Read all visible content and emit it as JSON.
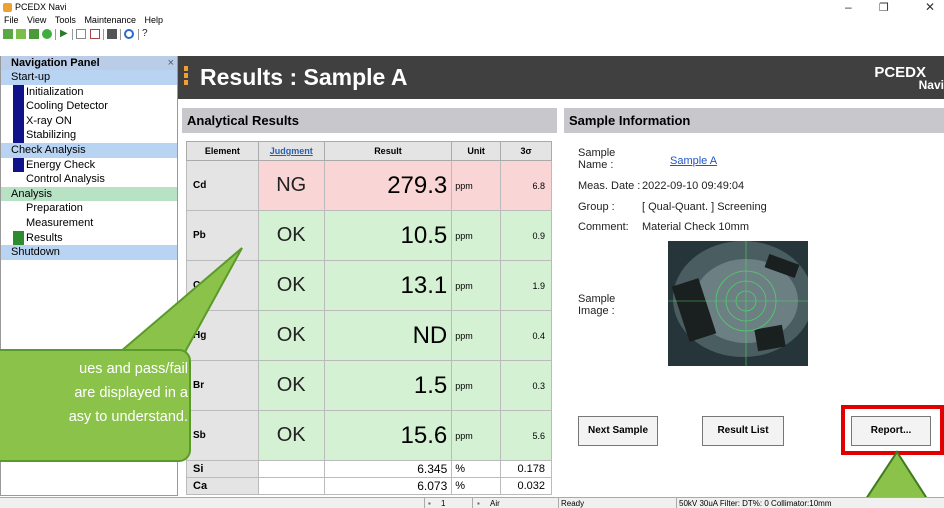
{
  "app": {
    "title": "PCEDX Navi",
    "menu": [
      "File",
      "View",
      "Tools",
      "Maintenance",
      "Help"
    ]
  },
  "nav": {
    "header": "Navigation Panel",
    "close": "×",
    "groups": [
      {
        "label": "Start-up",
        "items": [
          "Initialization",
          "Cooling Detector",
          "X-ray ON",
          "Stabilizing"
        ]
      },
      {
        "label": "Check Analysis",
        "items": [
          "Energy Check",
          "Control Analysis"
        ]
      },
      {
        "label": "Analysis",
        "items": [
          "Preparation",
          "Measurement",
          "Results"
        ]
      },
      {
        "label": "Shutdown",
        "items": []
      }
    ]
  },
  "header": {
    "title": "Results : Sample A",
    "brand": "PCEDX",
    "brand_sub": "Navi"
  },
  "results": {
    "section_title": "Analytical Results",
    "columns": [
      "Element",
      "Judgment",
      "Result",
      "Unit",
      "3σ"
    ],
    "rows": [
      {
        "element": "Cd",
        "judgment": "NG",
        "result": "279.3",
        "unit": "ppm",
        "sigma": "6.8"
      },
      {
        "element": "Pb",
        "judgment": "OK",
        "result": "10.5",
        "unit": "ppm",
        "sigma": "0.9"
      },
      {
        "element": "Cr",
        "judgment": "OK",
        "result": "13.1",
        "unit": "ppm",
        "sigma": "1.9"
      },
      {
        "element": "Hg",
        "judgment": "OK",
        "result": "ND",
        "unit": "ppm",
        "sigma": "0.4"
      },
      {
        "element": "Br",
        "judgment": "OK",
        "result": "1.5",
        "unit": "ppm",
        "sigma": "0.3"
      },
      {
        "element": "Sb",
        "judgment": "OK",
        "result": "15.6",
        "unit": "ppm",
        "sigma": "5.6"
      }
    ],
    "extra_rows": [
      {
        "element": "Si",
        "result": "6.345",
        "unit": "%",
        "sigma": "0.178"
      },
      {
        "element": "Ca",
        "result": "6.073",
        "unit": "%",
        "sigma": "0.032"
      }
    ]
  },
  "sample": {
    "section_title": "Sample Information",
    "name_label": "Sample Name :",
    "name_value": "Sample A",
    "date_label": "Meas. Date :",
    "date_value": "2022-09-10 09:49:04",
    "group_label": "Group :",
    "group_value": "[ Qual-Quant. ] Screening",
    "comment_label": "Comment:",
    "comment_value": "Material Check 10mm",
    "image_label": "Sample Image :"
  },
  "buttons": {
    "next": "Next Sample",
    "list": "Result List",
    "report": "Report..."
  },
  "callout": {
    "line1": "ues and pass/fail",
    "line2": "are displayed in a",
    "line3": "asy to understand."
  },
  "status": {
    "field1": "1",
    "field2": "Air",
    "state": "Ready",
    "params": "50kV  30uA  Filter: DT%: 0 Collimator:10mm"
  },
  "colors": {
    "ng": "#f9d5d5",
    "ok": "#d4f1d4",
    "callout": "#8bc34a",
    "report_frame": "#e00000",
    "header": "#404040",
    "accent": "#f0a030"
  }
}
